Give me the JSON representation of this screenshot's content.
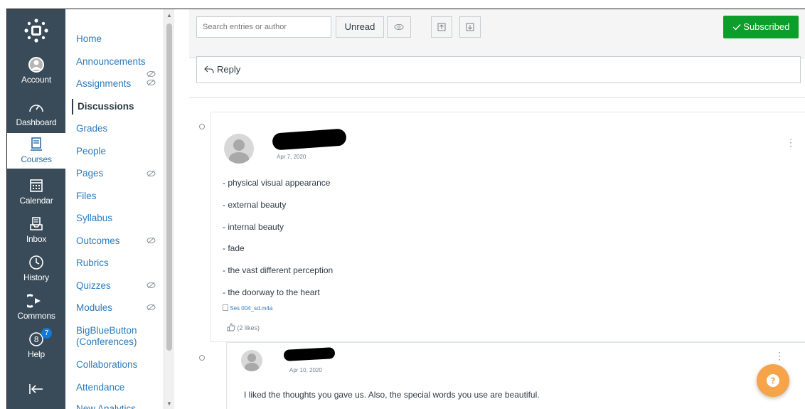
{
  "global_nav": {
    "items": [
      {
        "label": "Account"
      },
      {
        "label": "Dashboard"
      },
      {
        "label": "Courses"
      },
      {
        "label": "Calendar"
      },
      {
        "label": "Inbox"
      },
      {
        "label": "History"
      },
      {
        "label": "Commons"
      },
      {
        "label": "Help",
        "badge": "7"
      }
    ],
    "colors": {
      "background": "#394b58",
      "active_text": "#2d6da3"
    }
  },
  "course_nav": {
    "items": [
      {
        "label": "Home"
      },
      {
        "label": "Announcements"
      },
      {
        "label": "Assignments"
      },
      {
        "label": "Discussions"
      },
      {
        "label": "Grades"
      },
      {
        "label": "People"
      },
      {
        "label": "Pages"
      },
      {
        "label": "Files"
      },
      {
        "label": "Syllabus"
      },
      {
        "label": "Outcomes"
      },
      {
        "label": "Rubrics"
      },
      {
        "label": "Quizzes"
      },
      {
        "label": "Modules"
      },
      {
        "label": "BigBlueButton (Conferences)"
      },
      {
        "label": "Collaborations"
      },
      {
        "label": "Attendance"
      },
      {
        "label": "New Analytics"
      }
    ],
    "link_color": "#2d7bbb"
  },
  "toolbar": {
    "search_placeholder": "Search entries or author",
    "unread_label": "Unread",
    "subscribed_label": "Subscribed",
    "subscribed_color": "#0b9e2b"
  },
  "reply_label": "Reply",
  "posts": [
    {
      "date": "Apr 7, 2020",
      "lines": [
        "- physical visual appearance",
        "- external beauty",
        "- internal beauty",
        "- fade",
        "- the vast different perception",
        "- the doorway to the heart"
      ],
      "attachment": "Ses 004_sd.m4a",
      "likes": "(2 likes)"
    },
    {
      "date": "Apr 10, 2020",
      "body": "I liked the thoughts you gave us. Also, the special words you use are beautiful."
    }
  ]
}
